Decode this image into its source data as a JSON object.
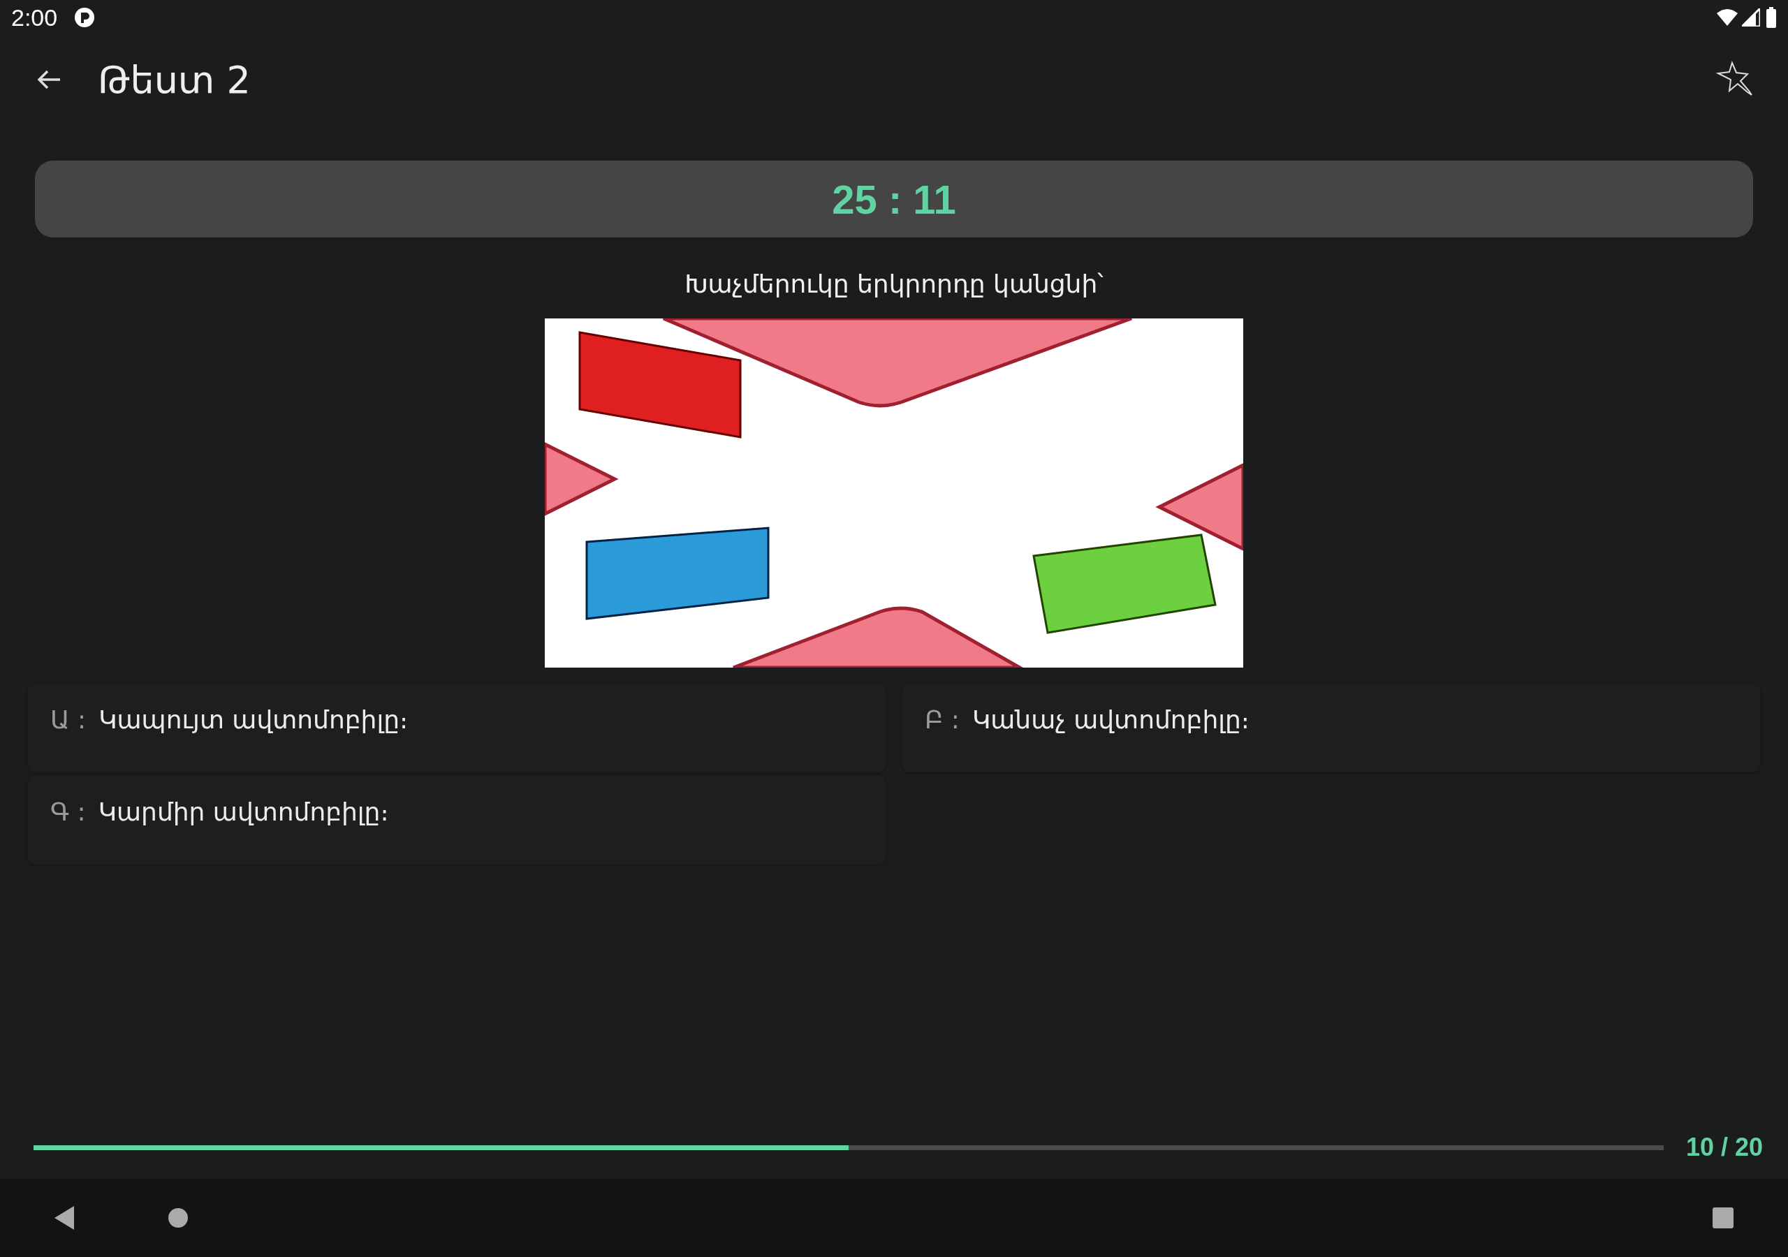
{
  "status_bar": {
    "time": "2:00"
  },
  "app_bar": {
    "title": "Թեստ 2"
  },
  "timer": "25 : 11",
  "question": "Խաչմերուկը երկրորդը կանցնի՝",
  "answers": [
    {
      "letter": "Ա :",
      "text": "Կապույտ ավտոմոբիլը։"
    },
    {
      "letter": "Բ :",
      "text": "Կանաչ ավտոմոբիլը։"
    },
    {
      "letter": "Գ :",
      "text": "Կարմիր ավտոմոբիլը։"
    }
  ],
  "progress": {
    "level": 0.5,
    "label": "10 / 20"
  }
}
